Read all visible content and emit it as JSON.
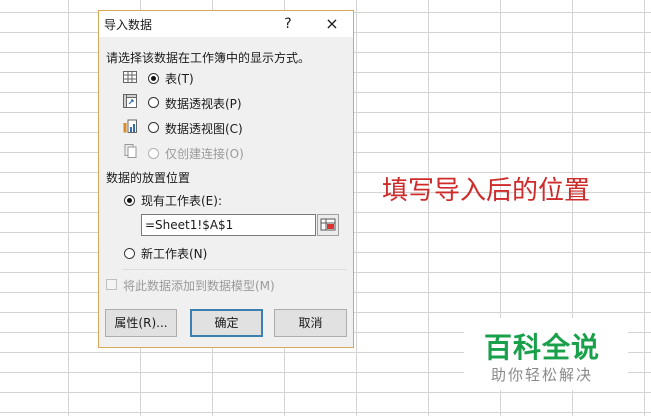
{
  "dialog": {
    "title": "导入数据",
    "help_label": "?",
    "close_label": "×",
    "prompt": "请选择该数据在工作簿中的显示方式。",
    "view_options": [
      {
        "label": "表(T)",
        "icon": "table-icon",
        "selected": true,
        "disabled": false
      },
      {
        "label": "数据透视表(P)",
        "icon": "pivot-table-icon",
        "selected": false,
        "disabled": false
      },
      {
        "label": "数据透视图(C)",
        "icon": "pivot-chart-icon",
        "selected": false,
        "disabled": false
      },
      {
        "label": "仅创建连接(O)",
        "icon": "connection-icon",
        "selected": false,
        "disabled": true
      }
    ],
    "placement_heading": "数据的放置位置",
    "existing_sheet_label": "现有工作表(E):",
    "cell_reference": "=Sheet1!$A$1",
    "new_sheet_label": "新工作表(N)",
    "data_model_label": "将此数据添加到数据模型(M)",
    "buttons": {
      "properties": "属性(R)...",
      "ok": "确定",
      "cancel": "取消"
    }
  },
  "annotation": "填写导入后的位置",
  "watermark": {
    "title": "百科全说",
    "subtitle": "助你轻松解决"
  },
  "colors": {
    "annotation": "#cf2b2b",
    "watermark_green": "#19a04b",
    "default_button_border": "#3c7fb1",
    "dialog_border": "#d6a85a"
  }
}
